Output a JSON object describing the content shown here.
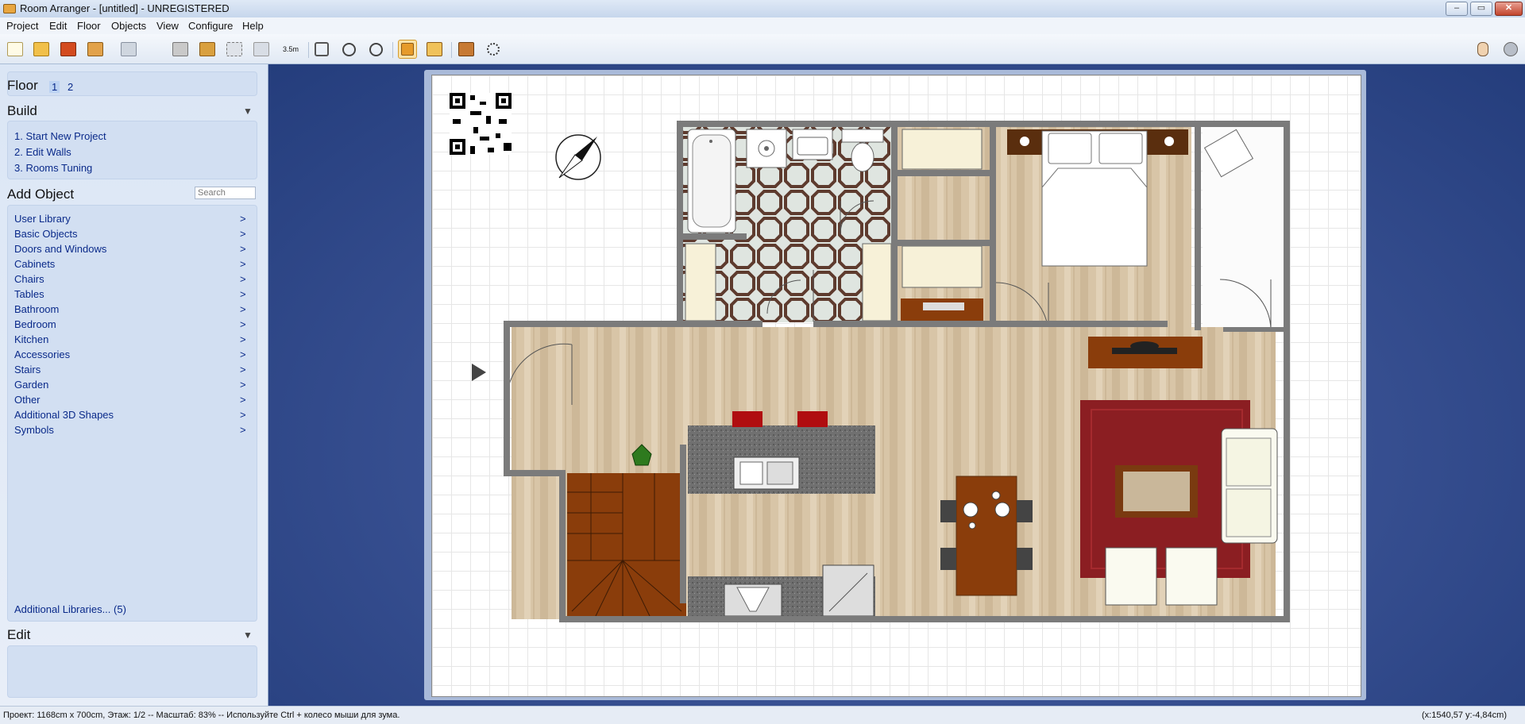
{
  "window": {
    "title": "Room Arranger - [untitled] - UNREGISTERED",
    "minimize": "–",
    "maximize": "▭",
    "close": "✕"
  },
  "menu": [
    "Project",
    "Edit",
    "Floor",
    "Objects",
    "View",
    "Configure",
    "Help"
  ],
  "toolbar": {
    "icons": [
      "new-project-icon",
      "open-icon",
      "save-icon",
      "print-icon",
      "export-icon",
      "wall-icon",
      "select-icon",
      "group-icon",
      "measure-icon",
      "zoom-fit-icon",
      "zoom-in-icon",
      "zoom-out-icon",
      "2d-view-icon",
      "3d-view-icon",
      "house-icon",
      "settings-icon"
    ],
    "measure_label": "3.5m",
    "active_index": 12
  },
  "sidebar": {
    "floor": {
      "label": "Floor",
      "numbers": [
        "1",
        "2"
      ],
      "selected": "1"
    },
    "build": {
      "title": "Build",
      "collapse": "▼",
      "items": [
        "1. Start New Project",
        "2. Edit Walls",
        "3. Rooms Tuning"
      ]
    },
    "add_object": {
      "title": "Add Object",
      "search_placeholder": "Search",
      "chevron": ">",
      "items": [
        "User Library",
        "Basic Objects",
        "Doors and Windows",
        "Cabinets",
        "Chairs",
        "Tables",
        "Bathroom",
        "Bedroom",
        "Kitchen",
        "Accessories",
        "Stairs",
        "Garden",
        "Other",
        "Additional 3D Shapes",
        "Symbols"
      ],
      "additional": "Additional Libraries... (5)"
    },
    "edit": {
      "title": "Edit",
      "collapse": "▼"
    }
  },
  "status": {
    "left": "Проект: 1168cm x 700cm, Этаж: 1/2 -- Масштаб: 83% -- Используйте Ctrl + колесо мыши для зума.",
    "right": "(x:1540,57 y:-4,84cm)"
  },
  "colors": {
    "canvas_bg": "#2f4a8c",
    "wall": "#7b7b7b",
    "wood_floor": "#d6c2a4",
    "rug": "#8b1e22",
    "furniture_wood": "#8a3d0b",
    "counter": "#6d6d6d"
  }
}
